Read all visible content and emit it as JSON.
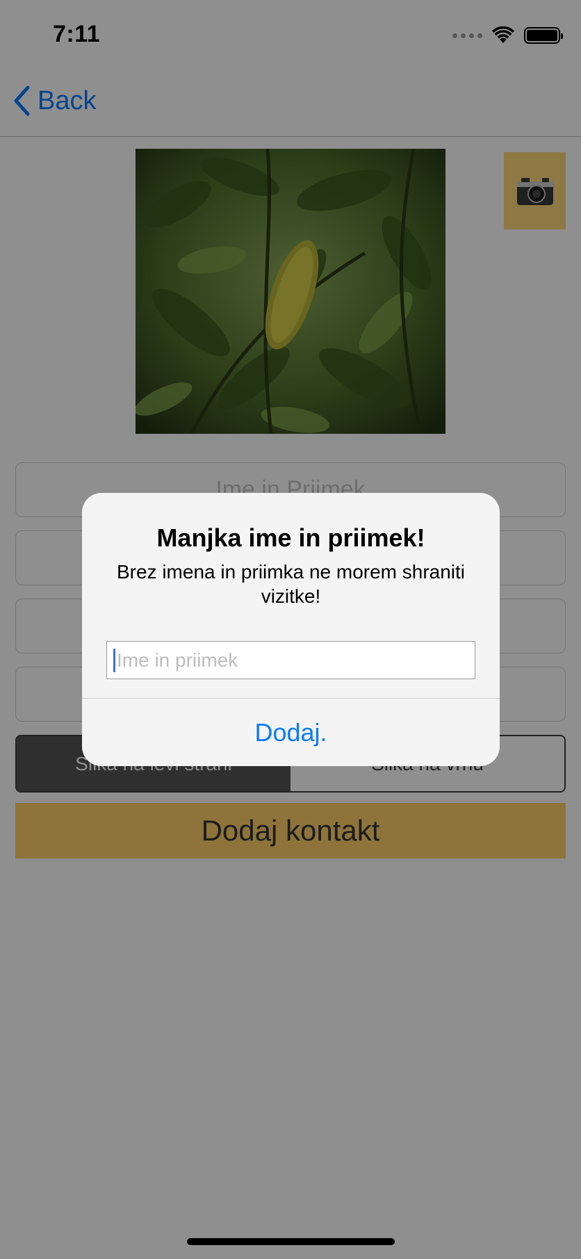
{
  "status_bar": {
    "time": "7:11"
  },
  "nav": {
    "back_label": "Back",
    "back_icon": "chevron-left-icon"
  },
  "content": {
    "photo_alt": "leaf-photo",
    "camera_icon": "📷",
    "fields": [
      {
        "placeholder": "Ime in Priimek"
      },
      {
        "placeholder": ""
      },
      {
        "placeholder": ""
      },
      {
        "placeholder": ""
      }
    ],
    "segment": [
      {
        "label": "Slika na levi strani",
        "selected": true
      },
      {
        "label": "Slika na vrhu",
        "selected": false
      }
    ],
    "add_button_label": "Dodaj kontakt"
  },
  "alert": {
    "title": "Manjka ime in priimek!",
    "message": "Brez imena in priimka ne morem shraniti vizitke!",
    "input_placeholder": "Ime in priimek",
    "input_value": "",
    "button_label": "Dodaj."
  },
  "colors": {
    "accent": "#0a7aff",
    "camera_button_bg": "#fdd67a",
    "add_button_bg": "#fdcf68",
    "segment_active": "#545454"
  }
}
